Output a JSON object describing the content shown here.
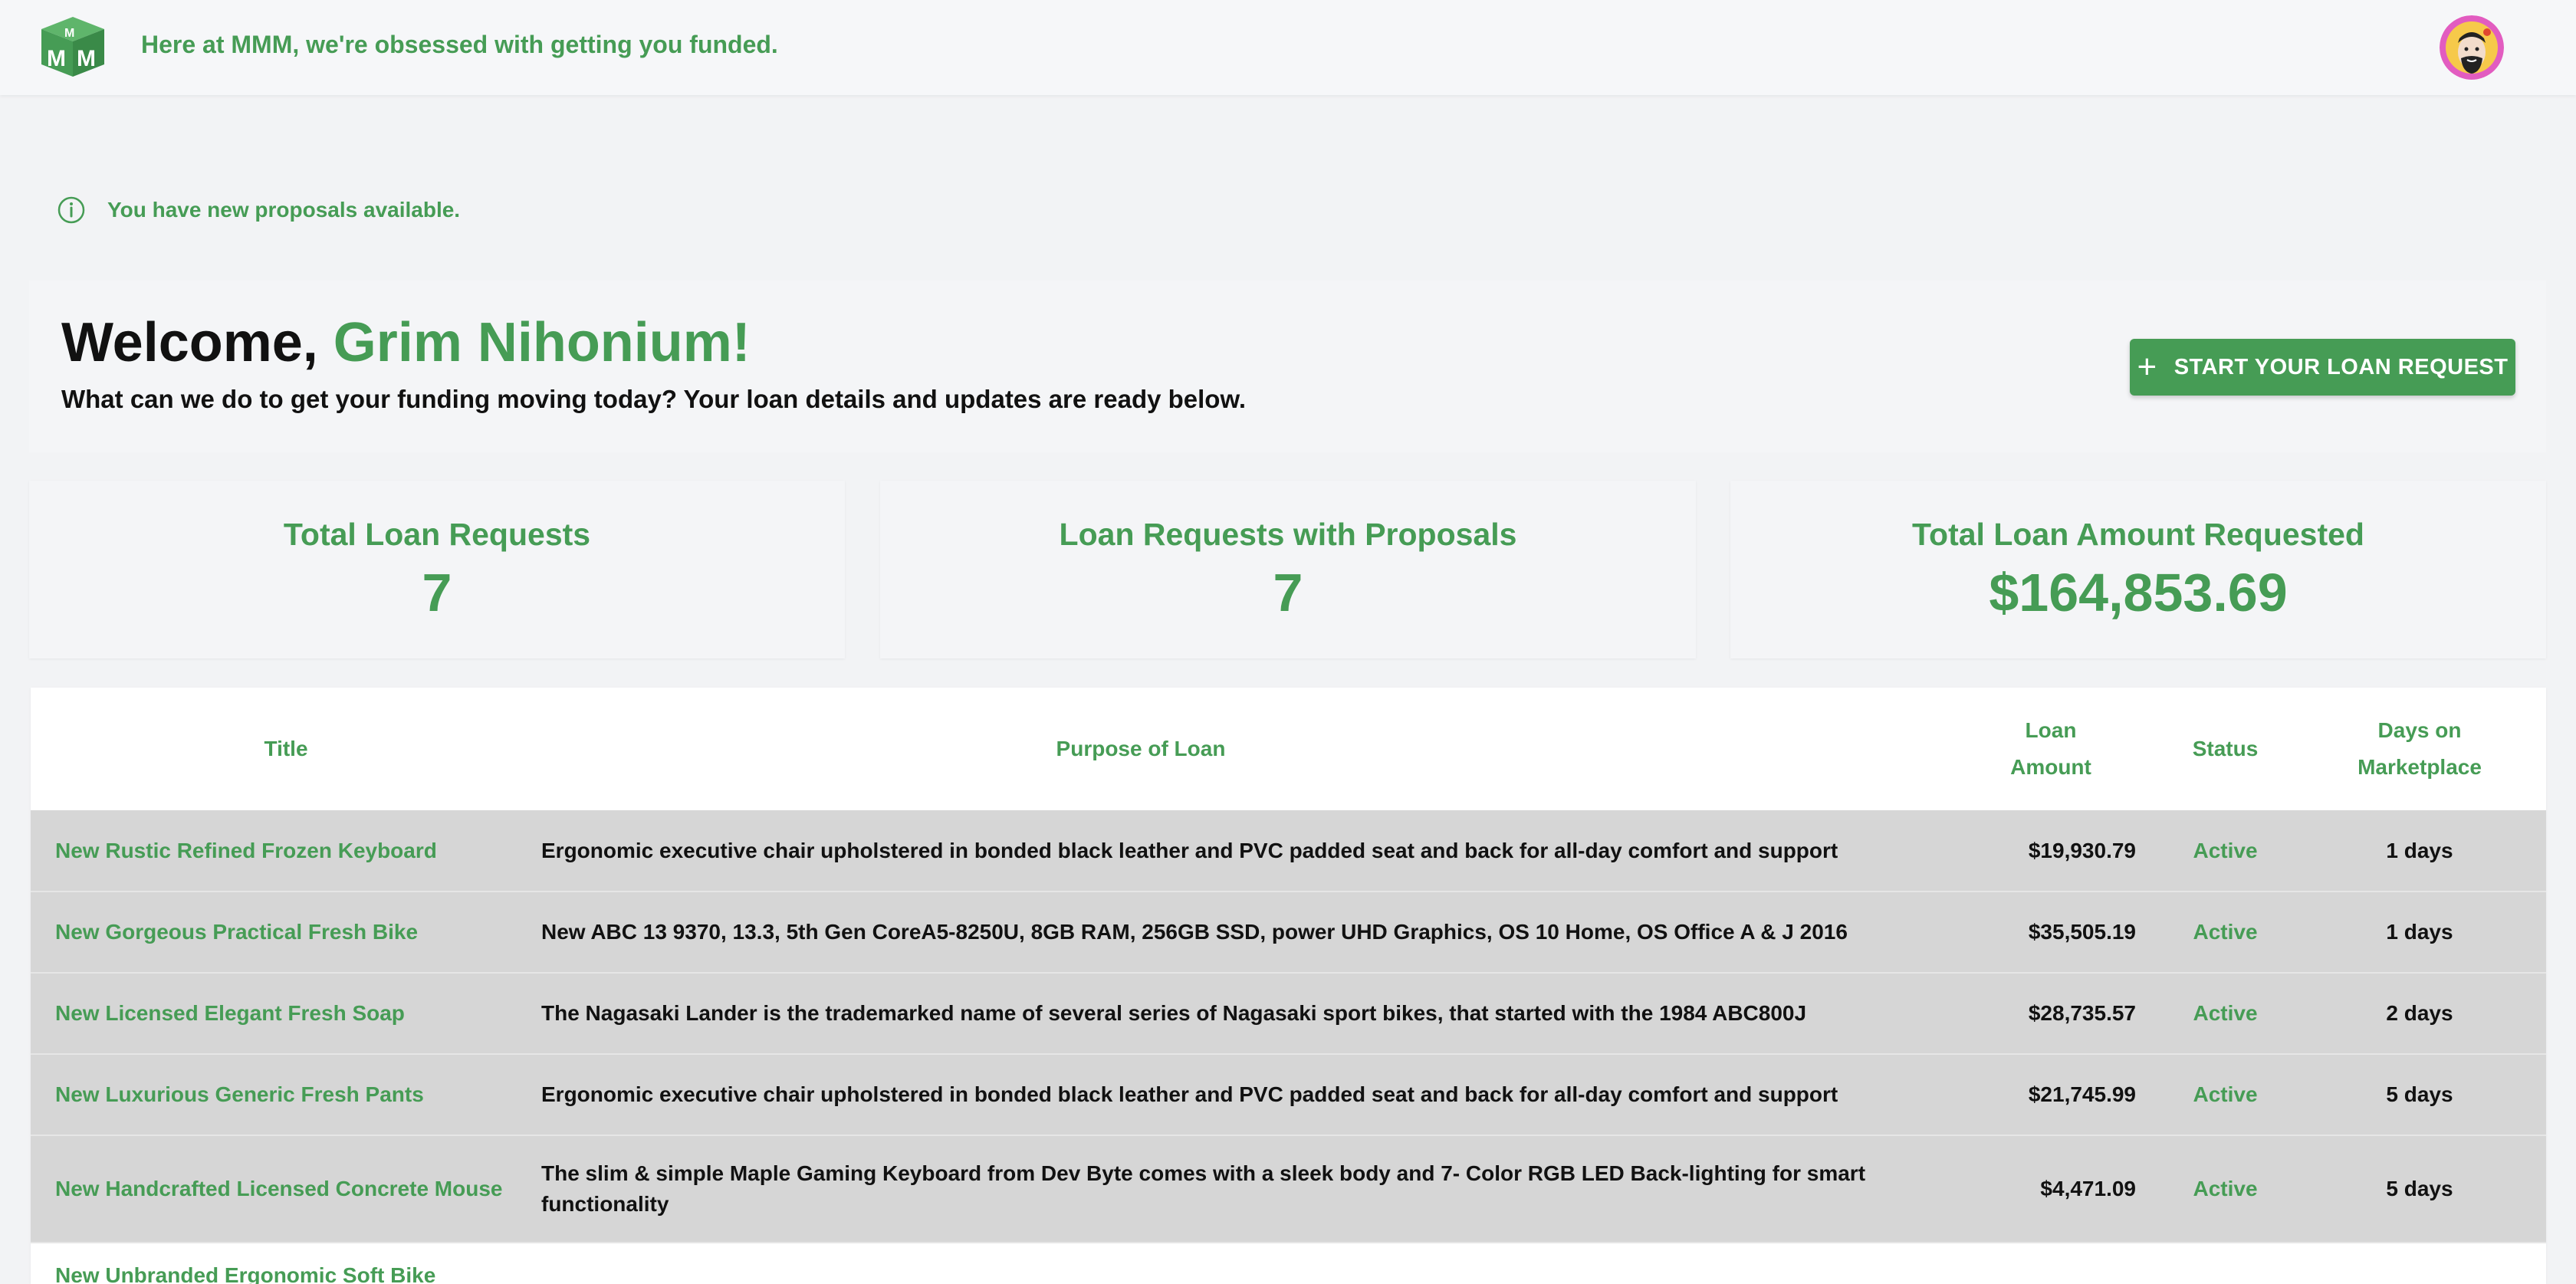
{
  "header": {
    "tagline": "Here at MMM, we're obsessed with getting you funded."
  },
  "alert": {
    "text": "You have new proposals available."
  },
  "welcome": {
    "greeting": "Welcome, ",
    "name": "Grim Nihonium!",
    "subtitle": "What can we do to get your funding moving today? Your loan details and updates are ready below.",
    "button_label": "START YOUR LOAN REQUEST"
  },
  "stats": [
    {
      "label": "Total Loan Requests",
      "value": "7"
    },
    {
      "label": "Loan Requests with Proposals",
      "value": "7"
    },
    {
      "label": "Total Loan Amount Requested",
      "value": "$164,853.69"
    }
  ],
  "table": {
    "headers": {
      "title": "Title",
      "purpose": "Purpose of Loan",
      "amount_line1": "Loan",
      "amount_line2": "Amount",
      "status": "Status",
      "days_line1": "Days on",
      "days_line2": "Marketplace"
    },
    "rows": [
      {
        "title": "New Rustic Refined Frozen Keyboard",
        "purpose": "Ergonomic executive chair upholstered in bonded black leather and PVC padded seat and back for all-day comfort and support",
        "amount": "$19,930.79",
        "status": "Active",
        "days": "1 days"
      },
      {
        "title": "New Gorgeous Practical Fresh Bike",
        "purpose": "New ABC 13 9370, 13.3, 5th Gen CoreA5-8250U, 8GB RAM, 256GB SSD, power UHD Graphics, OS 10 Home, OS Office A & J 2016",
        "amount": "$35,505.19",
        "status": "Active",
        "days": "1 days"
      },
      {
        "title": "New Licensed Elegant Fresh Soap",
        "purpose": "The Nagasaki Lander is the trademarked name of several series of Nagasaki sport bikes, that started with the 1984 ABC800J",
        "amount": "$28,735.57",
        "status": "Active",
        "days": "2 days"
      },
      {
        "title": "New Luxurious Generic Fresh Pants",
        "purpose": "Ergonomic executive chair upholstered in bonded black leather and PVC padded seat and back for all-day comfort and support",
        "amount": "$21,745.99",
        "status": "Active",
        "days": "5 days"
      },
      {
        "title": "New Handcrafted Licensed Concrete Mouse",
        "purpose": "The slim & simple Maple Gaming Keyboard from Dev Byte comes with a sleek body and 7- Color RGB LED Back-lighting for smart functionality",
        "amount": "$4,471.09",
        "status": "Active",
        "days": "5 days"
      },
      {
        "title": "New Unbranded Ergonomic Soft Bike",
        "purpose": "",
        "amount": "",
        "status": "",
        "days": ""
      }
    ]
  },
  "colors": {
    "brand_green": "#469c55",
    "row_gray": "#d6d6d6",
    "page_bg": "#f2f3f5"
  },
  "icons": {
    "logo": "mmm-cube-logo",
    "alert": "info-circle-icon",
    "button": "plus-icon",
    "avatar": "user-avatar"
  }
}
